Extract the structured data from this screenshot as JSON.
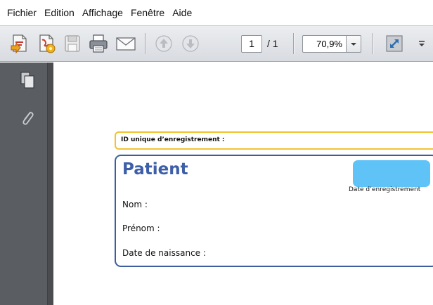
{
  "menu": {
    "items": [
      {
        "label": "Fichier"
      },
      {
        "label": "Edition"
      },
      {
        "label": "Affichage"
      },
      {
        "label": "Fenêtre"
      },
      {
        "label": "Aide"
      }
    ]
  },
  "toolbar": {
    "icons": [
      "open-file-icon",
      "create-pdf-icon",
      "save-icon",
      "print-icon",
      "email-icon",
      "previous-page-icon",
      "next-page-icon",
      "fit-page-icon",
      "more-tools-icon"
    ],
    "page_current": "1",
    "page_total": "/ 1",
    "zoom_value": "70,9%"
  },
  "sidebar": {
    "icons": [
      "pages-panel-icon",
      "attachments-icon"
    ]
  },
  "document": {
    "id_label": "ID unique d’enregistrement :",
    "patient_title": "Patient",
    "date_label": "Date d’enregistrement",
    "fields": {
      "nom": "Nom :",
      "prenom": "Prénom :",
      "naissance": "Date de naissance :"
    }
  },
  "colors": {
    "id_border": "#f3c230",
    "patient_border": "#3d5e9e",
    "patient_title": "#3d5ea8",
    "date_badge": "#5fc3f7",
    "sidebar": "#5a5d62"
  }
}
